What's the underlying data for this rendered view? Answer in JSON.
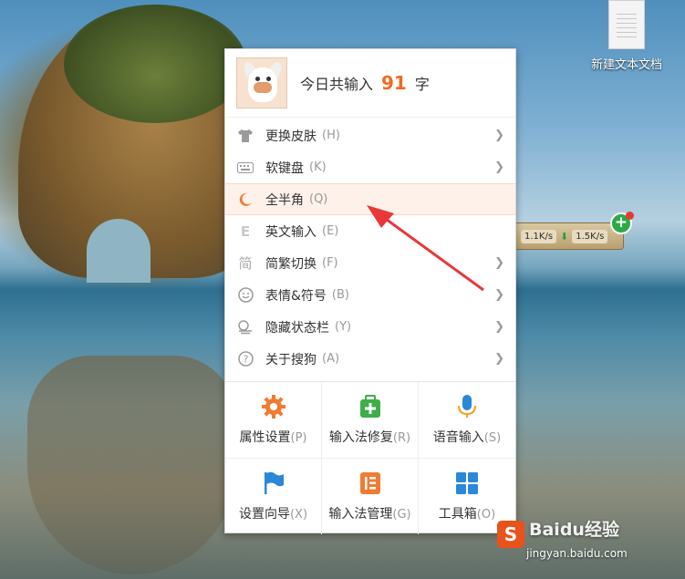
{
  "desktop": {
    "file_icon_label": "新建文本文档"
  },
  "speed_widget": {
    "upload": "1.1K/s",
    "download": "1.5K/s",
    "colors": {
      "download_arrow": "#2e9d3d",
      "plus_button": "#2fa846",
      "notification_dot": "#e53935"
    }
  },
  "menu": {
    "header": {
      "prefix": "今日共输入",
      "count": "91",
      "suffix": "字",
      "count_color": "#f06a22"
    },
    "items": [
      {
        "label": "更换皮肤",
        "key": "(H)",
        "icon": "shirt-icon",
        "has_submenu": true
      },
      {
        "label": "软键盘",
        "key": "(K)",
        "icon": "keyboard-icon",
        "has_submenu": true
      },
      {
        "label": "全半角",
        "key": "(Q)",
        "icon": "moon-icon",
        "has_submenu": false,
        "active": true
      },
      {
        "label": "英文输入",
        "key": "(E)",
        "icon": "letter-e-icon",
        "has_submenu": false
      },
      {
        "label": "简繁切换",
        "key": "(F)",
        "icon": "jian-char-icon",
        "has_submenu": true
      },
      {
        "label": "表情&符号",
        "key": "(B)",
        "icon": "smiley-icon",
        "has_submenu": true
      },
      {
        "label": "隐藏状态栏",
        "key": "(Y)",
        "icon": "hide-statusbar-icon",
        "has_submenu": true
      },
      {
        "label": "关于搜狗",
        "key": "(A)",
        "icon": "help-icon",
        "has_submenu": true
      }
    ],
    "grid": [
      {
        "label": "属性设置",
        "key": "(P)",
        "icon": "gear-icon",
        "color": "#f07b33"
      },
      {
        "label": "输入法修复",
        "key": "(R)",
        "icon": "repair-kit-icon",
        "color": "#3fae49"
      },
      {
        "label": "语音输入",
        "key": "(S)",
        "icon": "microphone-icon",
        "color": "#f2a31b"
      },
      {
        "label": "设置向导",
        "key": "(X)",
        "icon": "flag-icon",
        "color": "#2b87d8"
      },
      {
        "label": "输入法管理",
        "key": "(G)",
        "icon": "manage-list-icon",
        "color": "#f07b33"
      },
      {
        "label": "工具箱",
        "key": "(O)",
        "icon": "toolbox-grid-icon",
        "color": "#2b87d8"
      }
    ],
    "active_highlight": "#fdf1ea"
  },
  "watermark": {
    "logo_letter": "S",
    "text": "Baidu经验",
    "url": "jingyan.baidu.com"
  },
  "annotation": {
    "arrow_color": "#e8383a"
  }
}
